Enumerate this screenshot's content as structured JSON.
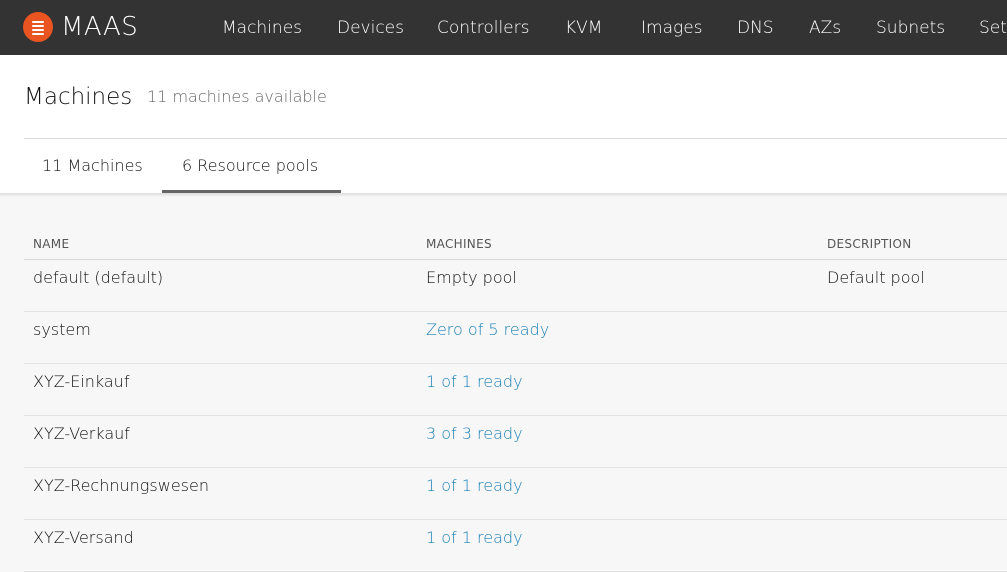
{
  "app": {
    "brand": "MAAS",
    "nav": [
      "Machines",
      "Devices",
      "Controllers",
      "KVM",
      "Images",
      "DNS",
      "AZs",
      "Subnets",
      "Set"
    ]
  },
  "header": {
    "title": "Machines",
    "subtitle": "11 machines available",
    "tabs": [
      "11 Machines",
      "6 Resource pools"
    ],
    "active_tab": "6 Resource pools"
  },
  "table": {
    "columns": [
      "NAME",
      "MACHINES",
      "DESCRIPTION"
    ],
    "rows": [
      {
        "name": "default (default)",
        "machines": "Empty pool",
        "description": "Default pool"
      },
      {
        "name": "system",
        "machines": "Zero of 5 ready",
        "description": ""
      },
      {
        "name": "XYZ-Einkauf",
        "machines": "1 of 1 ready",
        "description": ""
      },
      {
        "name": "XYZ-Verkauf",
        "machines": "3 of 3 ready",
        "description": ""
      },
      {
        "name": "XYZ-Rechnungswesen",
        "machines": "1 of 1 ready",
        "description": ""
      },
      {
        "name": "XYZ-Versand",
        "machines": "1 of 1 ready",
        "description": ""
      }
    ]
  },
  "colors": {
    "navbar": "#333333",
    "brand_orange": "#e95420",
    "link": "#1a7fb5"
  }
}
